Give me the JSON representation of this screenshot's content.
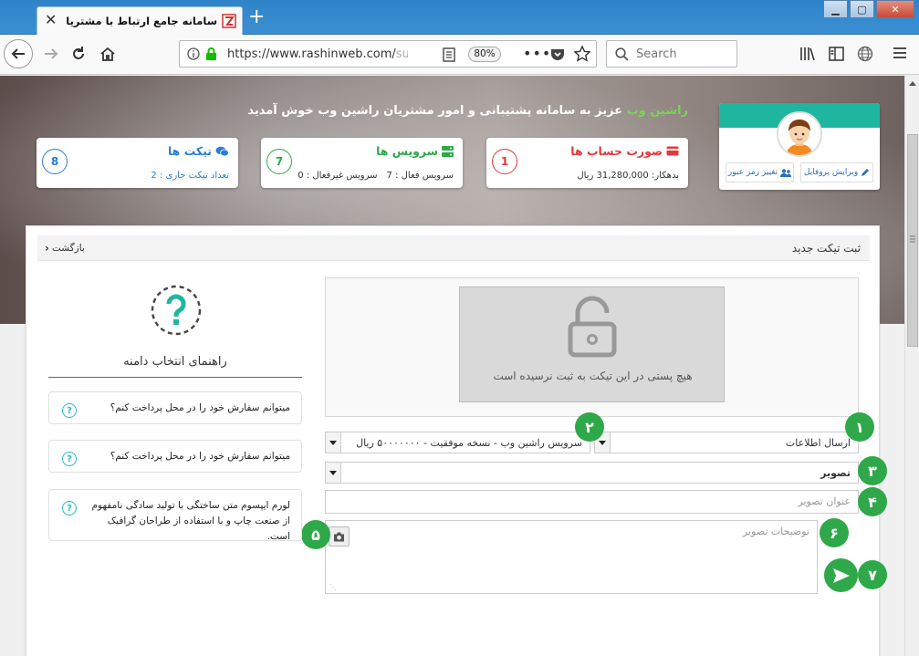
{
  "browser": {
    "tab_title": "سامانه جامع ارتباط با مشتریان راش",
    "url_main": "https://www.rashinweb.com/",
    "url_faded": "sup",
    "zoom": "80%",
    "search_placeholder": "Search"
  },
  "welcome": {
    "brand": "راشین وب",
    "text": " عزیز به سامانه پشتیبانی و امور مشتریان راشین وب خوش آمدید"
  },
  "cards": {
    "invoices": {
      "title": "صورت حساب ها",
      "sub": "بدهکار: 31,280,000 ریال",
      "count": "1",
      "color": "#e0393e"
    },
    "services": {
      "title": "سرویس ها",
      "active": "سرویس فعال : 7",
      "inactive": "سرویس غیرفعال : 0",
      "count": "7",
      "color": "#2fa84a"
    },
    "tickets": {
      "title": "تیکت ها",
      "sub": "تعداد تیکت جاری : 2",
      "count": "8",
      "color": "#2a7fd4"
    }
  },
  "profile": {
    "edit_profile": "ویرایش پروفایل",
    "change_password": "تغییر رمز عبور"
  },
  "panel": {
    "title": "ثبت تیکت جدید",
    "back": "بازگشت",
    "no_post": "هیچ پستی در این تیکت به ثبت نرسیده است"
  },
  "form": {
    "type_select": "ارسال اطلاعات",
    "service_select": "سرویس راشین وب - نسخه موفقیت - ۵۰۰۰۰۰۰۰ ریال",
    "attach_select": "تصویر",
    "image_title_placeholder": "عنوان تصویر",
    "image_desc_placeholder": "توضیحات تصویر"
  },
  "badges": [
    "۱",
    "۲",
    "۳",
    "۴",
    "۵",
    "۶",
    "۷"
  ],
  "sidebar": {
    "title": "راهنمای انتخاب دامنه",
    "faqs": [
      "میتوانم سفارش خود را در محل پرداخت کنم؟",
      "میتوانم سفارش خود را در محل پرداخت کنم؟",
      "لورم ایپسوم متن ساختگی با تولید سادگی نامفهوم از صنعت چاپ و با استفاده از طراحان گرافیک است."
    ]
  },
  "colors": {
    "accent_green": "#2fa84a",
    "teal": "#1fb6a0",
    "red": "#e0393e",
    "blue": "#2a7fd4"
  },
  "icons": [
    "back-arrow-icon",
    "forward-arrow-icon",
    "reload-icon",
    "home-icon",
    "info-icon",
    "lock-icon",
    "reader-icon",
    "more-icon",
    "pocket-icon",
    "bookmark-star-icon",
    "search-icon",
    "library-icon",
    "sidebar-icon",
    "globe-icon",
    "menu-icon",
    "camera-icon",
    "send-icon",
    "question-icon",
    "padlock-icon"
  ]
}
